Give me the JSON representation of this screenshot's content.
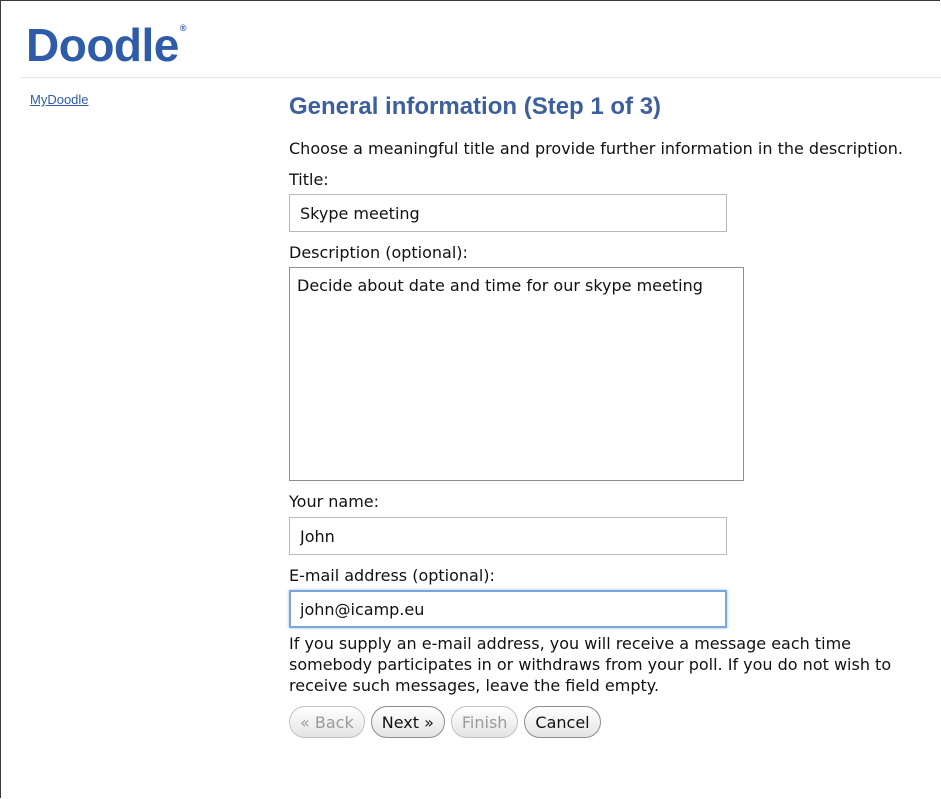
{
  "header": {
    "logo_text": "Doodle",
    "logo_mark": "®"
  },
  "nav": {
    "mydoodle_label": "MyDoodle"
  },
  "form": {
    "title": "General information (Step 1 of 3)",
    "intro": "Choose a meaningful title and provide further information in the description.",
    "title_label": "Title:",
    "title_value": "Skype meeting",
    "description_label": "Description (optional):",
    "description_value": "Decide about date and time for our skype meeting",
    "name_label": "Your name:",
    "name_value": "John",
    "email_label": "E-mail address (optional):",
    "email_value": "john@icamp.eu",
    "email_help": "If you supply an e-mail address, you will receive a message each time somebody participates in or withdraws from your poll. If you do not wish to receive such messages, leave the field empty."
  },
  "buttons": {
    "back_label": "« Back",
    "next_label": "Next »",
    "finish_label": "Finish",
    "cancel_label": "Cancel"
  },
  "colors": {
    "brand": "#2e5ca8",
    "title": "#3d5f9c",
    "focus_border": "#7ba6dc"
  }
}
